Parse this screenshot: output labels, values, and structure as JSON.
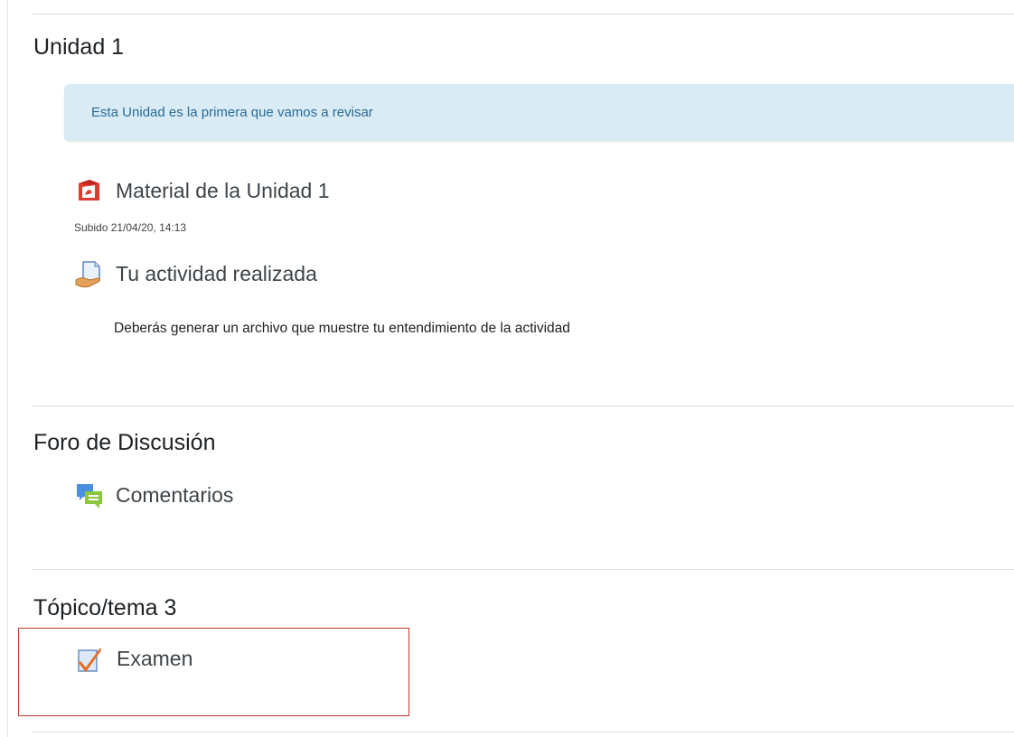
{
  "sections": [
    {
      "title": "Unidad 1",
      "summary": "Esta Unidad es la primera que vamos a revisar",
      "activities": [
        {
          "name": "Material de la Unidad 1",
          "icon": "pdf-icon",
          "meta": "Subido 21/04/20, 14:13"
        },
        {
          "name": "Tu actividad realizada",
          "icon": "assignment-icon",
          "description": "Deberás generar un archivo que muestre tu entendimiento de la actividad"
        }
      ]
    },
    {
      "title": "Foro de Discusión",
      "activities": [
        {
          "name": "Comentarios",
          "icon": "forum-icon"
        }
      ]
    },
    {
      "title": "Tópico/tema 3",
      "activities": [
        {
          "name": "Examen",
          "icon": "quiz-icon"
        }
      ]
    }
  ],
  "colors": {
    "highlight_border": "#c0392b",
    "summary_background": "#d9ecf5",
    "summary_text": "#2a6a96"
  }
}
